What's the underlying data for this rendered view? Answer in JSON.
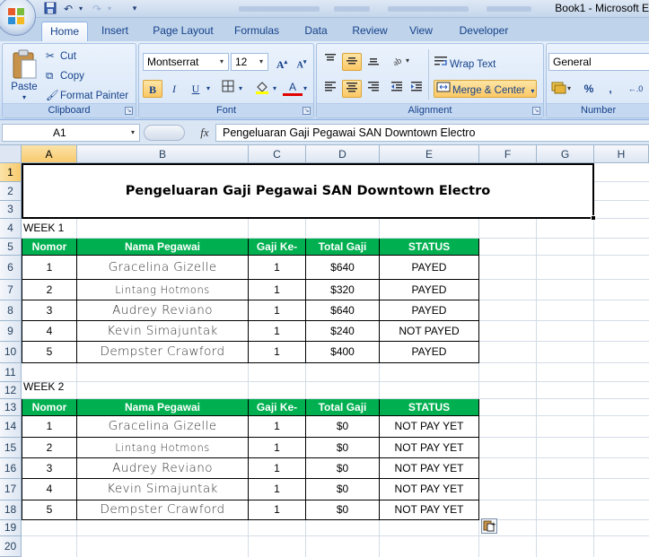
{
  "window": {
    "title": "Book1 - Microsoft E"
  },
  "ribbon": {
    "tabs": [
      {
        "label": "Home",
        "active": true
      },
      {
        "label": "Insert"
      },
      {
        "label": "Page Layout"
      },
      {
        "label": "Formulas"
      },
      {
        "label": "Data"
      },
      {
        "label": "Review"
      },
      {
        "label": "View"
      },
      {
        "label": "Developer"
      }
    ],
    "clipboard": {
      "label": "Clipboard",
      "paste": "Paste",
      "cut": "Cut",
      "copy": "Copy",
      "format_painter": "Format Painter"
    },
    "font": {
      "label": "Font",
      "name": "Montserrat",
      "size": "12"
    },
    "alignment": {
      "label": "Alignment",
      "wrap_text": "Wrap Text",
      "merge_center": "Merge & Center"
    },
    "number": {
      "label": "Number",
      "format": "General",
      "percent": "%",
      "comma": ","
    }
  },
  "formula_bar": {
    "name_box": "A1",
    "fx": "fx",
    "content": "Pengeluaran Gaji Pegawai SAN Downtown Electro"
  },
  "sheet": {
    "columns": [
      "A",
      "B",
      "C",
      "D",
      "E",
      "F",
      "G",
      "H"
    ],
    "rows": [
      "1",
      "2",
      "3",
      "4",
      "5",
      "6",
      "7",
      "8",
      "9",
      "10",
      "11",
      "12",
      "13",
      "14",
      "15",
      "16",
      "17",
      "18",
      "19",
      "20"
    ],
    "title": "Pengeluaran Gaji Pegawai SAN Downtown Electro",
    "headers": [
      "Nomor",
      "Nama Pegawai",
      "Gaji Ke-",
      "Total Gaji",
      "STATUS"
    ],
    "week1": {
      "label": "WEEK 1",
      "rows": [
        {
          "no": "1",
          "name": "Gracelina Gizelle",
          "gaji": "1",
          "total": "$640",
          "status": "PAYED"
        },
        {
          "no": "2",
          "name": "Lintang Hotmons",
          "gaji": "1",
          "total": "$320",
          "status": "PAYED"
        },
        {
          "no": "3",
          "name": "Audrey Reviano",
          "gaji": "1",
          "total": "$640",
          "status": "PAYED"
        },
        {
          "no": "4",
          "name": "Kevin Simajuntak",
          "gaji": "1",
          "total": "$240",
          "status": "NOT PAYED"
        },
        {
          "no": "5",
          "name": "Dempster Crawford",
          "gaji": "1",
          "total": "$400",
          "status": "PAYED"
        }
      ]
    },
    "week2": {
      "label": "WEEK 2",
      "rows": [
        {
          "no": "1",
          "name": "Gracelina Gizelle",
          "gaji": "1",
          "total": "$0",
          "status": "NOT PAY YET"
        },
        {
          "no": "2",
          "name": "Lintang Hotmons",
          "gaji": "1",
          "total": "$0",
          "status": "NOT PAY YET"
        },
        {
          "no": "3",
          "name": "Audrey Reviano",
          "gaji": "1",
          "total": "$0",
          "status": "NOT PAY YET"
        },
        {
          "no": "4",
          "name": "Kevin Simajuntak",
          "gaji": "1",
          "total": "$0",
          "status": "NOT PAY YET"
        },
        {
          "no": "5",
          "name": "Dempster Crawford",
          "gaji": "1",
          "total": "$0",
          "status": "NOT PAY YET"
        }
      ]
    }
  },
  "colors": {
    "header_green": "#00b050",
    "accent": "#15428b",
    "selection": "#f8ca6d"
  }
}
